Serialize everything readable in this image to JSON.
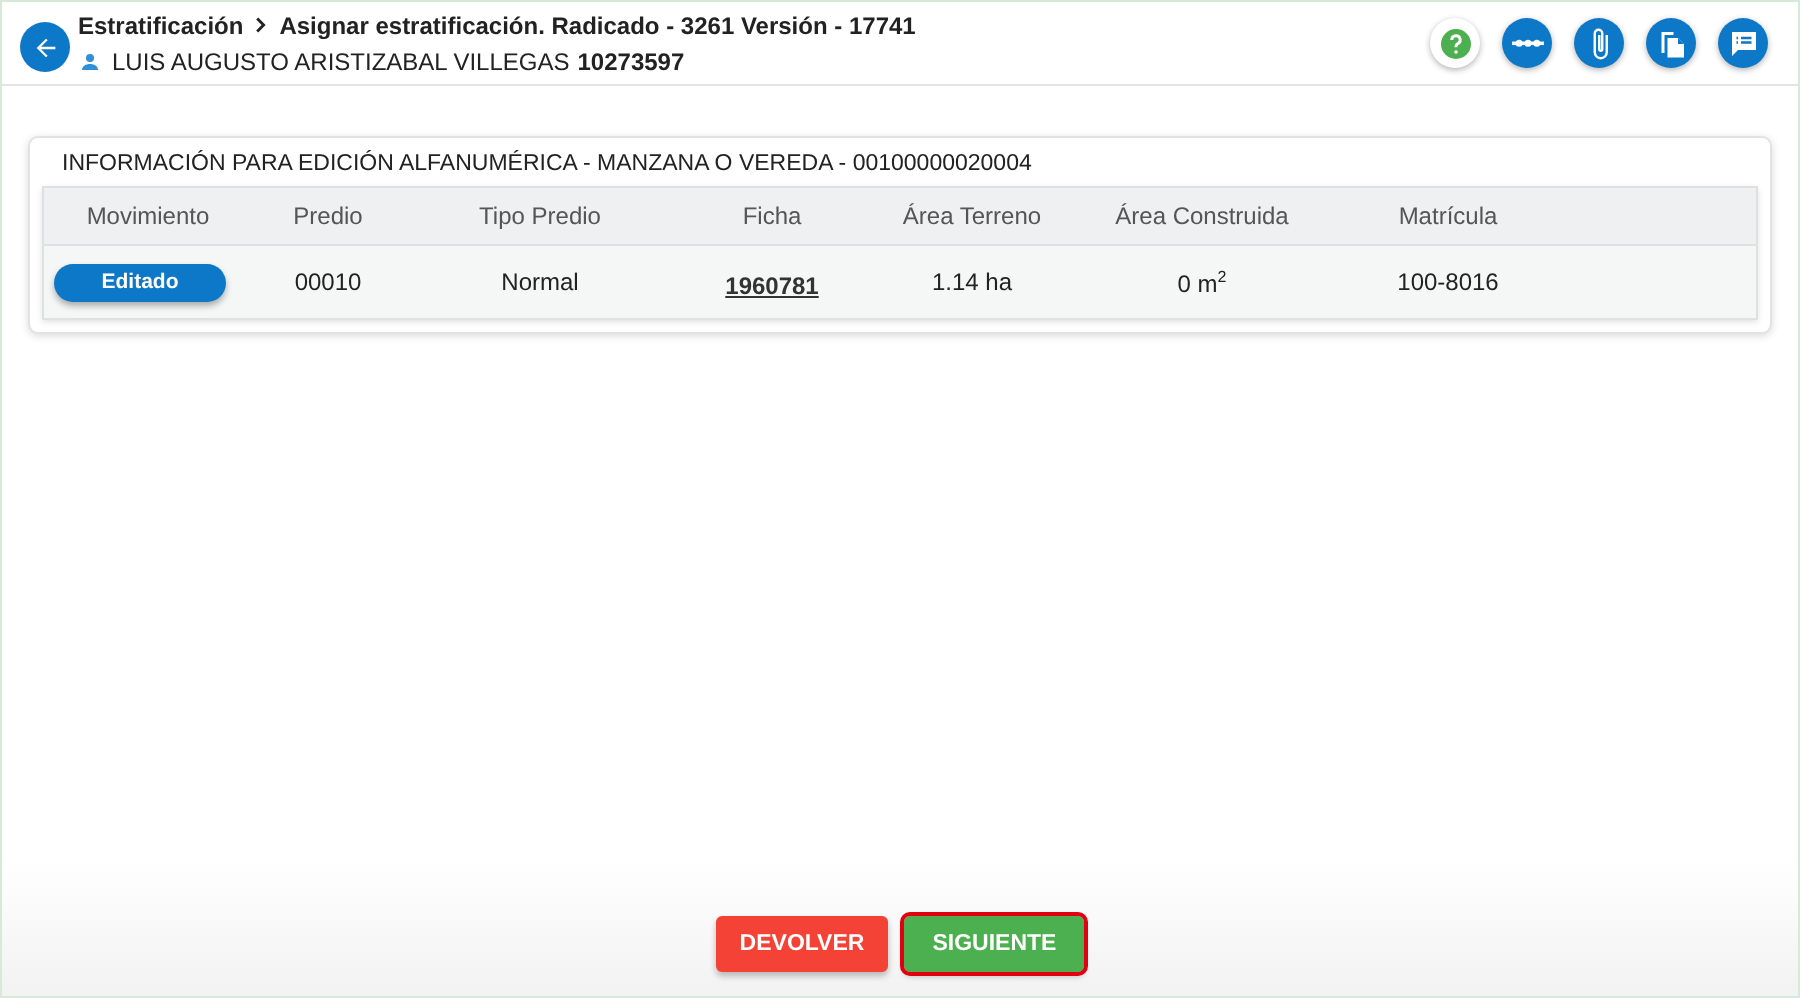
{
  "header": {
    "breadcrumb": [
      "Estratificación",
      "Asignar estratificación. Radicado - 3261 Versión - 17741"
    ],
    "user_name": "LUIS AUGUSTO ARISTIZABAL VILLEGAS",
    "user_id": "10273597"
  },
  "card": {
    "title": "INFORMACIÓN PARA EDICIÓN ALFANUMÉRICA - MANZANA O VEREDA - 00100000020004",
    "table": {
      "columns": [
        "Movimiento",
        "Predio",
        "Tipo Predio",
        "Ficha",
        "Área Terreno",
        "Área Construida",
        "Matrícula"
      ],
      "rows": [
        [
          {
            "kind": "badge",
            "text": "Editado"
          },
          {
            "kind": "text",
            "text": "00010"
          },
          {
            "kind": "text",
            "text": "Normal"
          },
          {
            "kind": "link",
            "text": "1960781"
          },
          {
            "kind": "text",
            "text": "1.14 ha"
          },
          {
            "kind": "text",
            "text": "0 m$^{2}$"
          },
          {
            "kind": "text",
            "text": "100-8016"
          }
        ]
      ]
    }
  },
  "actions": [
    {
      "label": "DEVOLVER",
      "kind": "danger",
      "focused": false
    },
    {
      "label": "SIGUIENTE",
      "kind": "success",
      "focused": true
    }
  ]
}
